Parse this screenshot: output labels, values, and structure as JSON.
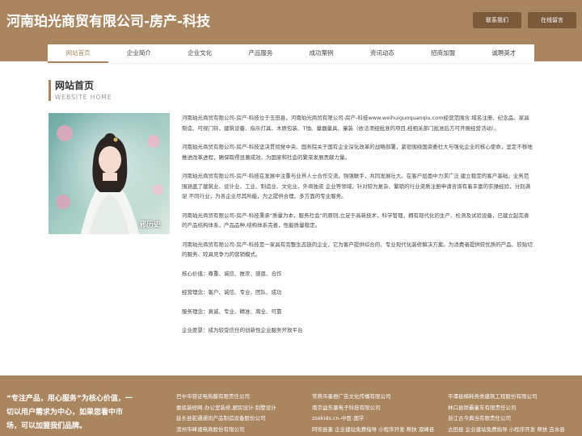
{
  "header": {
    "title": "河南珀光商贸有限公司-房产-科技",
    "contact_btn": "联系我们",
    "message_btn": "在线留言"
  },
  "nav": {
    "items": [
      "网站首页",
      "企业简介",
      "企业文化",
      "产品服务",
      "成功案例",
      "资讯动态",
      "招商加盟",
      "诚聘英才"
    ]
  },
  "section": {
    "title": "网站首页",
    "subtitle": "WEBSITE HOME"
  },
  "photo": {
    "watermark": "邪历史"
  },
  "content": {
    "paragraphs": [
      "河南珀光商贸有限公司-房产-科技位于玉田县，河南珀光商贸有限公司-房产-科技www.weihuiguoquanqiu.com经营范围含:域名注册、纪念品、家具制造、可视门铃、建筑设备、指示灯具、木质包装、T恤、量器量具、童装（依法须经批准的项目,经相关部门批准后方可开展经营活动）。",
      "河南珀光商贸有限公司-房产-科技坚决贯彻党中央、国务院关于国有企业深化改革的战略部署，紧密围绕国资委社大与强化企业的核心使命，坚定不移地推进改革进程，确保取得显著成效，为国家和社会的繁荣发展贡献力量。",
      "河南珀光商贸有限公司-房产-科技在发展中注重与业界人士合作交流，强强联手，共同发展壮大。在客户层面中力求广泛 建立稳定的客户基础，业务范围涵盖了建筑业、设计业、工业、制造业、文化业、外商独资 企业等领域，针对较为复杂、繁琐的行业资质注册申请咨询有着丰富的实操经验，分别满足 不同行业，为各企业尽其所能，为之提供合理、多方面的专业服务。",
      "河南珀光商贸有限公司-房产-科技秉承“质量为本，服务社会”的原则,立足于高新技术，科学管理，拥有现代化的生产、检测及试验设备，已建立起完善的产品结构体系，产品品种,结构体系完善，性能质量稳定。",
      "河南珀光商贸有限公司-房产-科技是一家具有完整生态链的企业，它为客户提供综合的、专业现代化装修解决方案。为消费者提供较优质的产品、较贴切的服务、较具竞争力的营销模式。",
      "核心价值：尊重、诚信、推崇、感恩、合作",
      "经营理念：客户、诚信、专业、团队、成功",
      "服务理念：真诚、专业、精准、周全、可靠",
      "企业愿景：成为较受信任的创新性企业服务开放平台"
    ]
  },
  "footer": {
    "slogan": "“专注产品，用心服务”为核心价值，一切以用户需求为中心，如果您看中市场，可以加盟我们品牌。",
    "links_col1": [
      "巴中市容证电热膜有限责任公司",
      "娄底装修网-办公室装修,厨房设计-别墅设计",
      "延长县驼通通讯产品制造设备股份公司",
      "滨州市峰诸电商股份有限公司"
    ],
    "links_col2": [
      "常熟市墨橙广告文化传播有限公司",
      "南京益东塞电子科技有限公司",
      "zsekids.cn-中医-国学",
      "阿坝县墨 企业建站免费指导 小程序开发 帮扶 双峰县"
    ],
    "links_col3": [
      "平潭县楠耗务类建筑工程股份有限公司",
      "林口县铧霸童车有限责任公司",
      "浙江古今典当有限责任公司",
      "古田县 企业建站免费指导 小程序开发 帮扶 吉水县"
    ]
  },
  "colors": {
    "brand": "#a98560",
    "button_dark": "#7b5a3c"
  }
}
